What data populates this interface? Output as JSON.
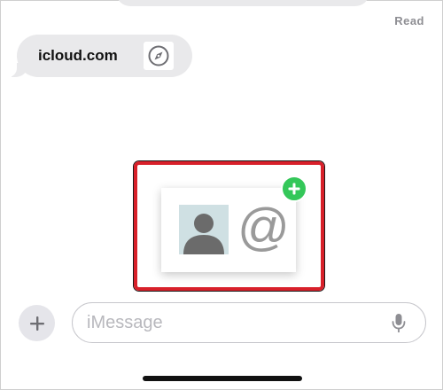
{
  "conversation": {
    "read_receipt": "Read",
    "link_bubble": {
      "text": "icloud.com",
      "icon": "compass-icon"
    }
  },
  "sticker": {
    "avatar_icon": "person-silhouette-icon",
    "at_symbol": "@",
    "badge_icon": "plus-icon",
    "badge_color": "#34c759",
    "highlight_color": "#d8202a"
  },
  "composer": {
    "apps_icon": "plus-icon",
    "placeholder": "iMessage",
    "value": "",
    "mic_icon": "microphone-icon"
  }
}
